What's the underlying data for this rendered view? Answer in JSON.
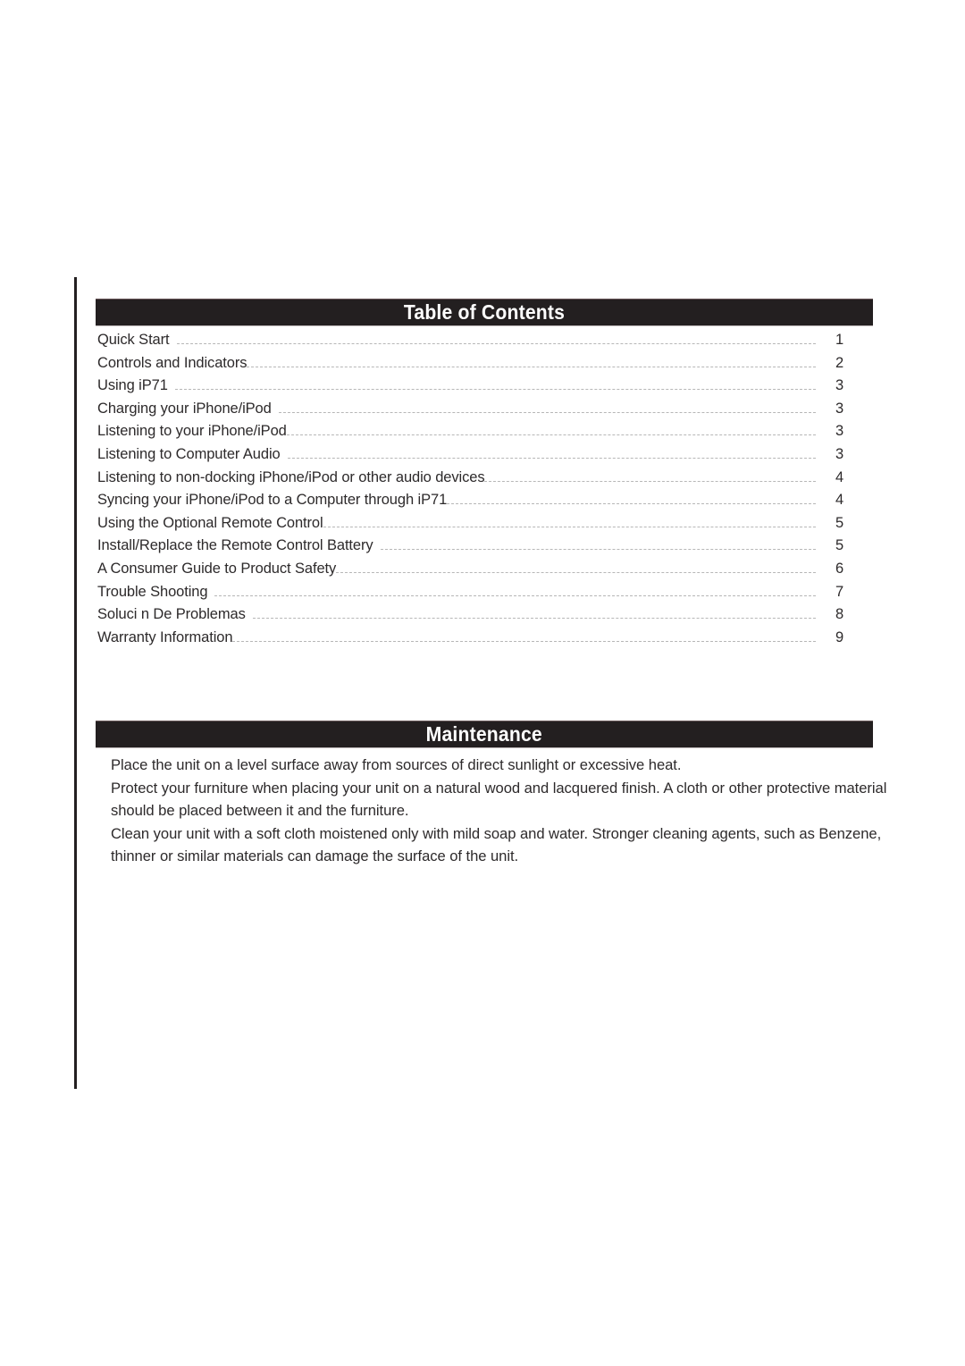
{
  "page": {
    "background_color": "#ffffff",
    "rule_color": "#231f20",
    "accent_bar_color": "#231f20",
    "bar_text_color": "#ffffff",
    "body_text_color": "#2d2a2b",
    "leader_color": "#b7b7b7"
  },
  "toc": {
    "heading": "Table of Contents",
    "entries": [
      {
        "label": "Quick Start",
        "page": "1"
      },
      {
        "label": "Controls and Indicators",
        "page": "2"
      },
      {
        "label": "Using iP71",
        "page": "3"
      },
      {
        "label": "Charging your iPhone/iPod",
        "page": "3"
      },
      {
        "label": "Listening to your iPhone/iPod",
        "page": "3"
      },
      {
        "label": "Listening to Computer Audio",
        "page": "3"
      },
      {
        "label": "Listening to non-docking iPhone/iPod or other audio devices",
        "page": "4"
      },
      {
        "label": "Syncing your iPhone/iPod to a Computer through iP71",
        "page": "4"
      },
      {
        "label": "Using the Optional Remote Control",
        "page": "5"
      },
      {
        "label": "Install/Replace the Remote Control Battery",
        "page": "5"
      },
      {
        "label": "A Consumer Guide to Product Safety",
        "page": "6"
      },
      {
        "label": "Trouble Shooting",
        "page": "7"
      },
      {
        "label": "Soluci n De Problemas",
        "page": "8"
      },
      {
        "label": "Warranty Information",
        "page": "9"
      }
    ]
  },
  "maintenance": {
    "heading": "Maintenance",
    "paragraphs": [
      "Place the unit on a level surface away from sources of direct sunlight or excessive heat.",
      "Protect your furniture when placing your unit on a natural wood and lacquered finish. A cloth or other protective material should be placed between it and the furniture.",
      "Clean your unit with a soft cloth moistened only with mild soap and water. Stronger cleaning agents, such as Benzene, thinner or similar materials can damage the surface of the unit."
    ]
  }
}
